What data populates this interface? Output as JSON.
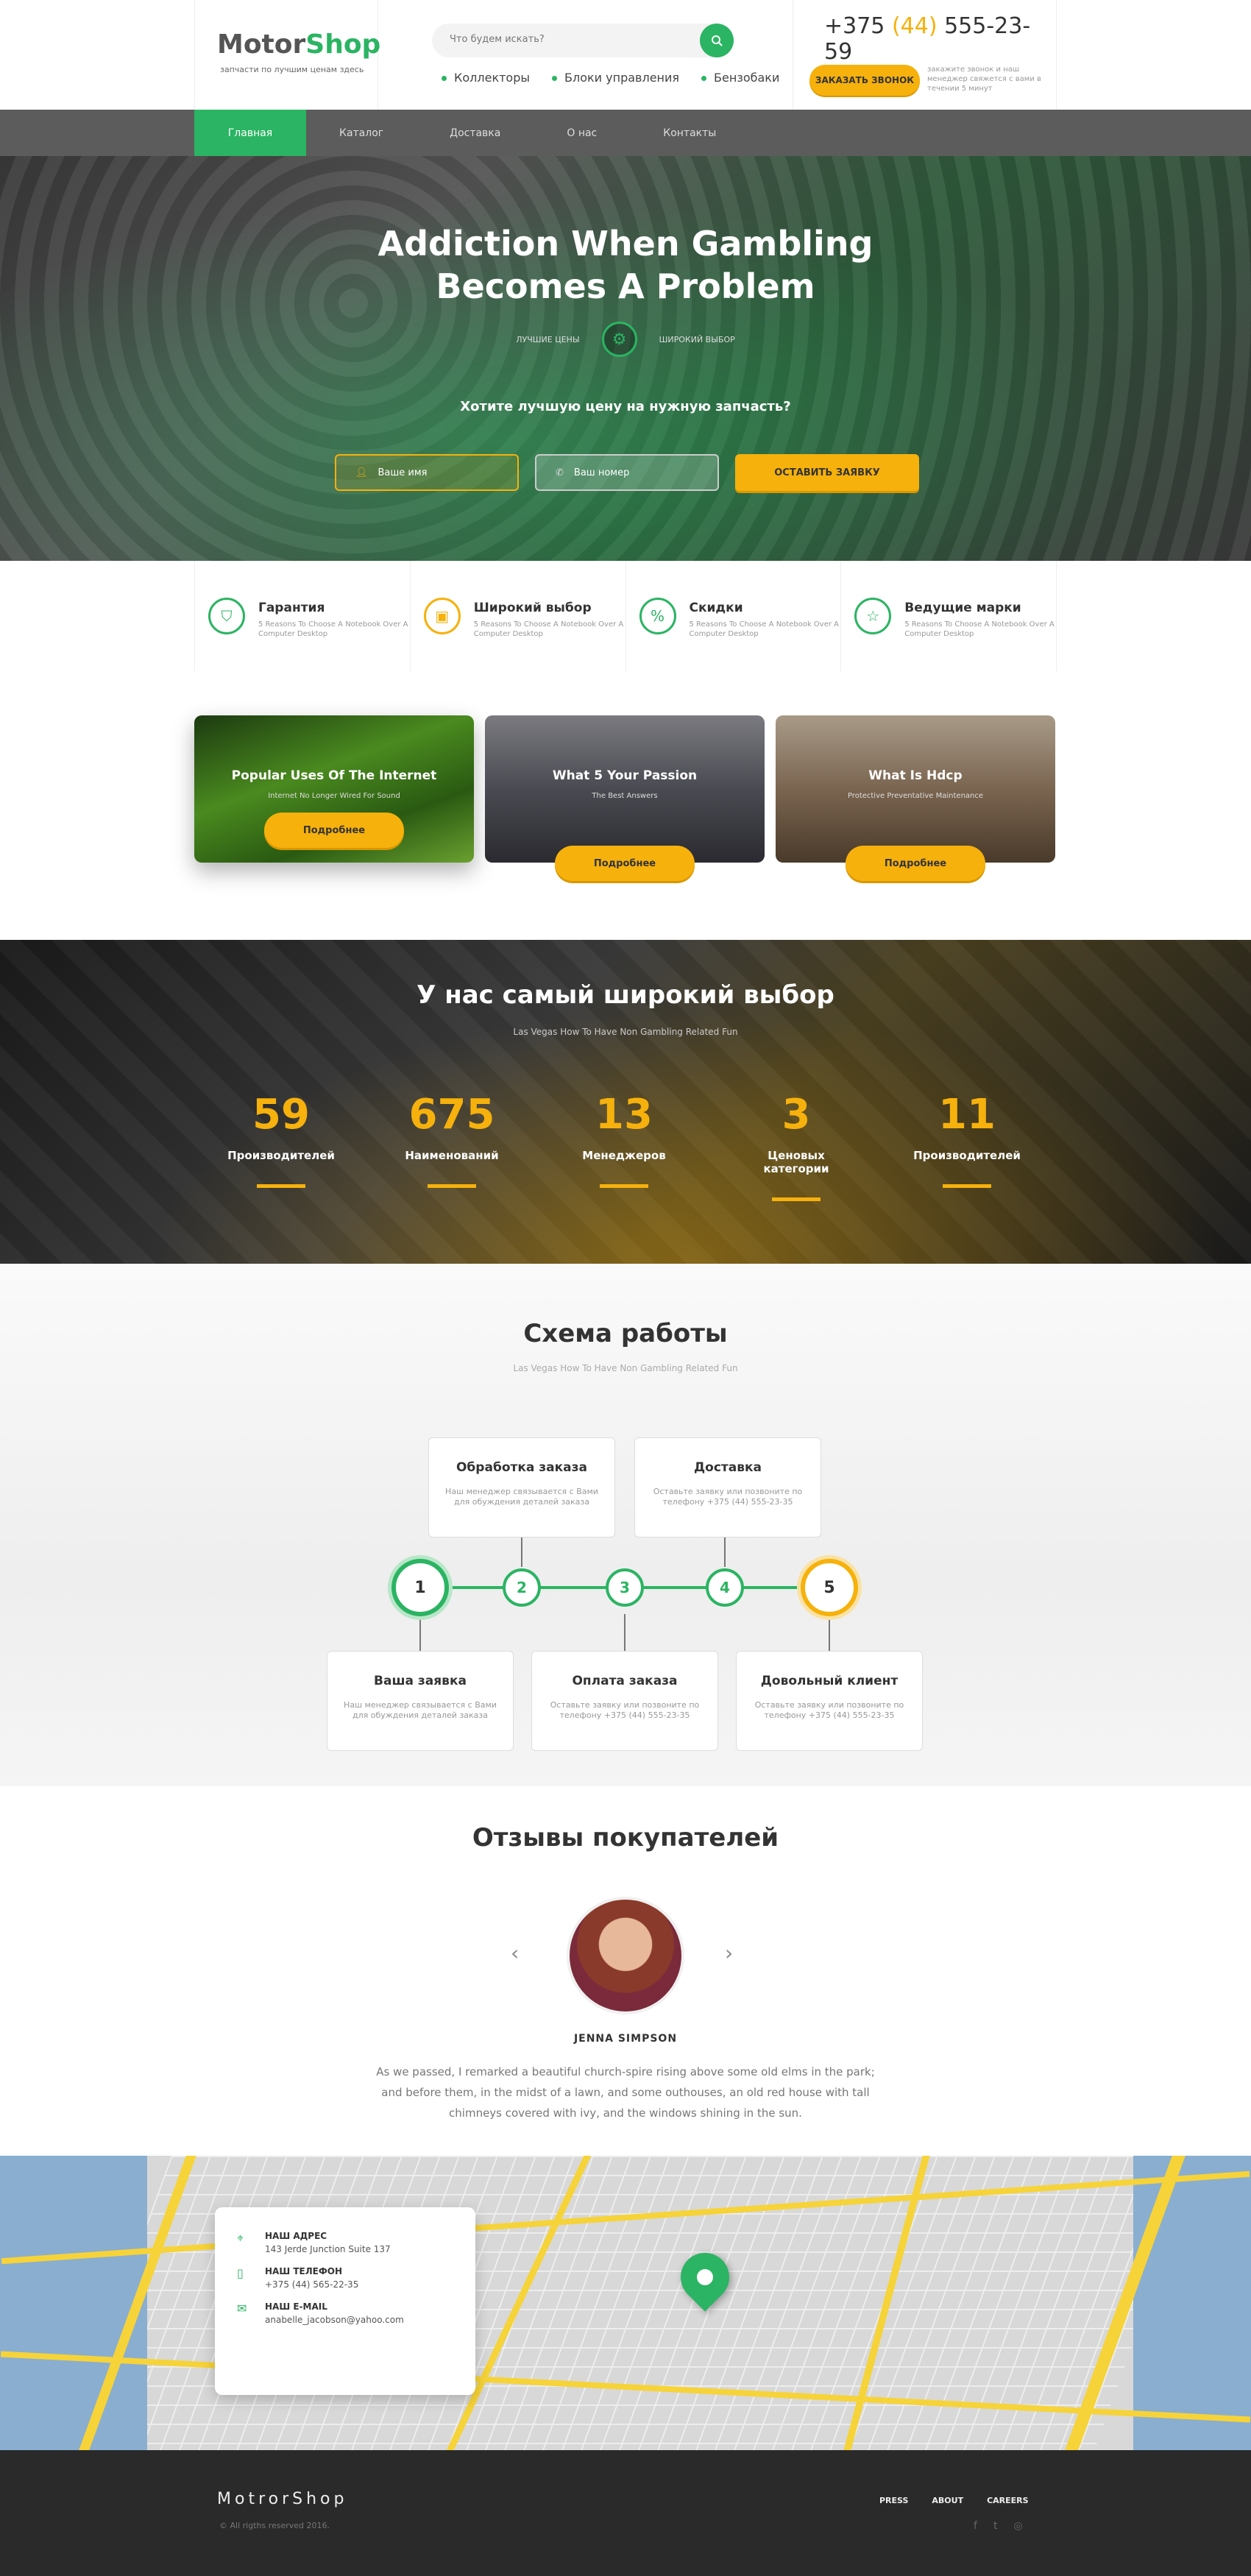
{
  "header": {
    "logo_main": "Motor",
    "logo_accent": "Shop",
    "logo_sub": "запчасти по лучшим ценам здесь",
    "search_placeholder": "Что будем искать?",
    "quick_links": [
      "Коллекторы",
      "Блоки управления",
      "Бензобаки"
    ],
    "phone_prefix": "+375",
    "phone_code": "(44)",
    "phone_number": "555-23-59",
    "call_button": "ЗАКАЗАТЬ ЗВОНОК",
    "call_note": "закажите звонок и наш менеджер свяжется с вами в течении 5 минут"
  },
  "nav": [
    "Главная",
    "Каталог",
    "Доставка",
    "О нас",
    "Контакты"
  ],
  "hero": {
    "title_line1": "Addiction When Gambling",
    "title_line2": "Becomes A Problem",
    "tag_left": "ЛУЧШИЕ ЦЕНЫ",
    "tag_right": "ШИРОКИЙ ВЫБОР",
    "question": "Хотите лучшую цену на нужную запчасть?",
    "name_placeholder": "Ваше имя",
    "phone_placeholder": "Ваш номер",
    "submit": "ОСТАВИТЬ ЗАЯВКУ"
  },
  "features": [
    {
      "title": "Гарантия",
      "desc": "5 Reasons To Choose A Notebook Over A Computer Desktop",
      "icon": "shield-icon"
    },
    {
      "title": "Широкий выбор",
      "desc": "5 Reasons To Choose A Notebook Over A Computer Desktop",
      "icon": "box-icon"
    },
    {
      "title": "Скидки",
      "desc": "5 Reasons To Choose A Notebook Over A Computer Desktop",
      "icon": "percent-icon"
    },
    {
      "title": "Ведущие марки",
      "desc": "5 Reasons To Choose A Notebook Over A Computer Desktop",
      "icon": "star-icon"
    }
  ],
  "cards": [
    {
      "title": "Popular Uses Of The Internet",
      "subtitle": "Internet No Longer Wired For Sound",
      "button": "Подробнее"
    },
    {
      "title": "What 5 Your Passion",
      "subtitle": "The Best Answers",
      "button": "Подробнее"
    },
    {
      "title": "What Is Hdcp",
      "subtitle": "Protective Preventative Maintenance",
      "button": "Подробнее"
    }
  ],
  "stats": {
    "title": "У нас самый широкий выбор",
    "subtitle": "Las Vegas How To Have Non Gambling Related Fun",
    "items": [
      {
        "value": "59",
        "label": "Производителей"
      },
      {
        "value": "675",
        "label": "Наименований"
      },
      {
        "value": "13",
        "label": "Менеджеров"
      },
      {
        "value": "3",
        "label": "Ценовых категории"
      },
      {
        "value": "11",
        "label": "Производителей"
      }
    ]
  },
  "scheme": {
    "title": "Схема работы",
    "subtitle": "Las Vegas How To Have Non Gambling Related Fun",
    "steps": [
      {
        "num": "1",
        "title": "Ваша заявка",
        "desc": "Наш менеджер связывается с Вами для обуждения деталей заказа"
      },
      {
        "num": "2",
        "title": "Обработка заказа",
        "desc": "Наш менеджер связывается с Вами для обуждения деталей заказа"
      },
      {
        "num": "3",
        "title": "Оплата заказа",
        "desc": "Оставьте заявку или позвоните по телефону +375 (44) 555-23-35"
      },
      {
        "num": "4",
        "title": "Доставка",
        "desc": "Оставьте заявку или позвоните по телефону +375 (44) 555-23-35"
      },
      {
        "num": "5",
        "title": "Довольный клиент",
        "desc": "Оставьте заявку или позвоните по телефону +375 (44) 555-23-35"
      }
    ]
  },
  "reviews": {
    "title": "Отзывы покупателей",
    "name": "JENNA SIMPSON",
    "text": "As we passed, I remarked a beautiful church-spire rising above some old elms in the park; and before them, in the midst of a lawn, and some outhouses, an old red house with tall chimneys covered with ivy, and the windows shining in the sun."
  },
  "contacts": {
    "address_label": "НАШ АДРЕС",
    "address": "143 Jerde Junction Suite 137",
    "phone_label": "НАШ ТЕЛЕФОН",
    "phone": "+375 (44) 565-22-35",
    "email_label": "НАШ E-MAIL",
    "email": "anabelle_jacobson@yahoo.com"
  },
  "footer": {
    "logo": "MotrorShop",
    "copyright": "© All rigths reserved 2016.",
    "links": [
      "PRESS",
      "ABOUT",
      "CAREERS"
    ]
  },
  "colors": {
    "accent_green": "#2bb463",
    "accent_yellow": "#f6b10c"
  }
}
